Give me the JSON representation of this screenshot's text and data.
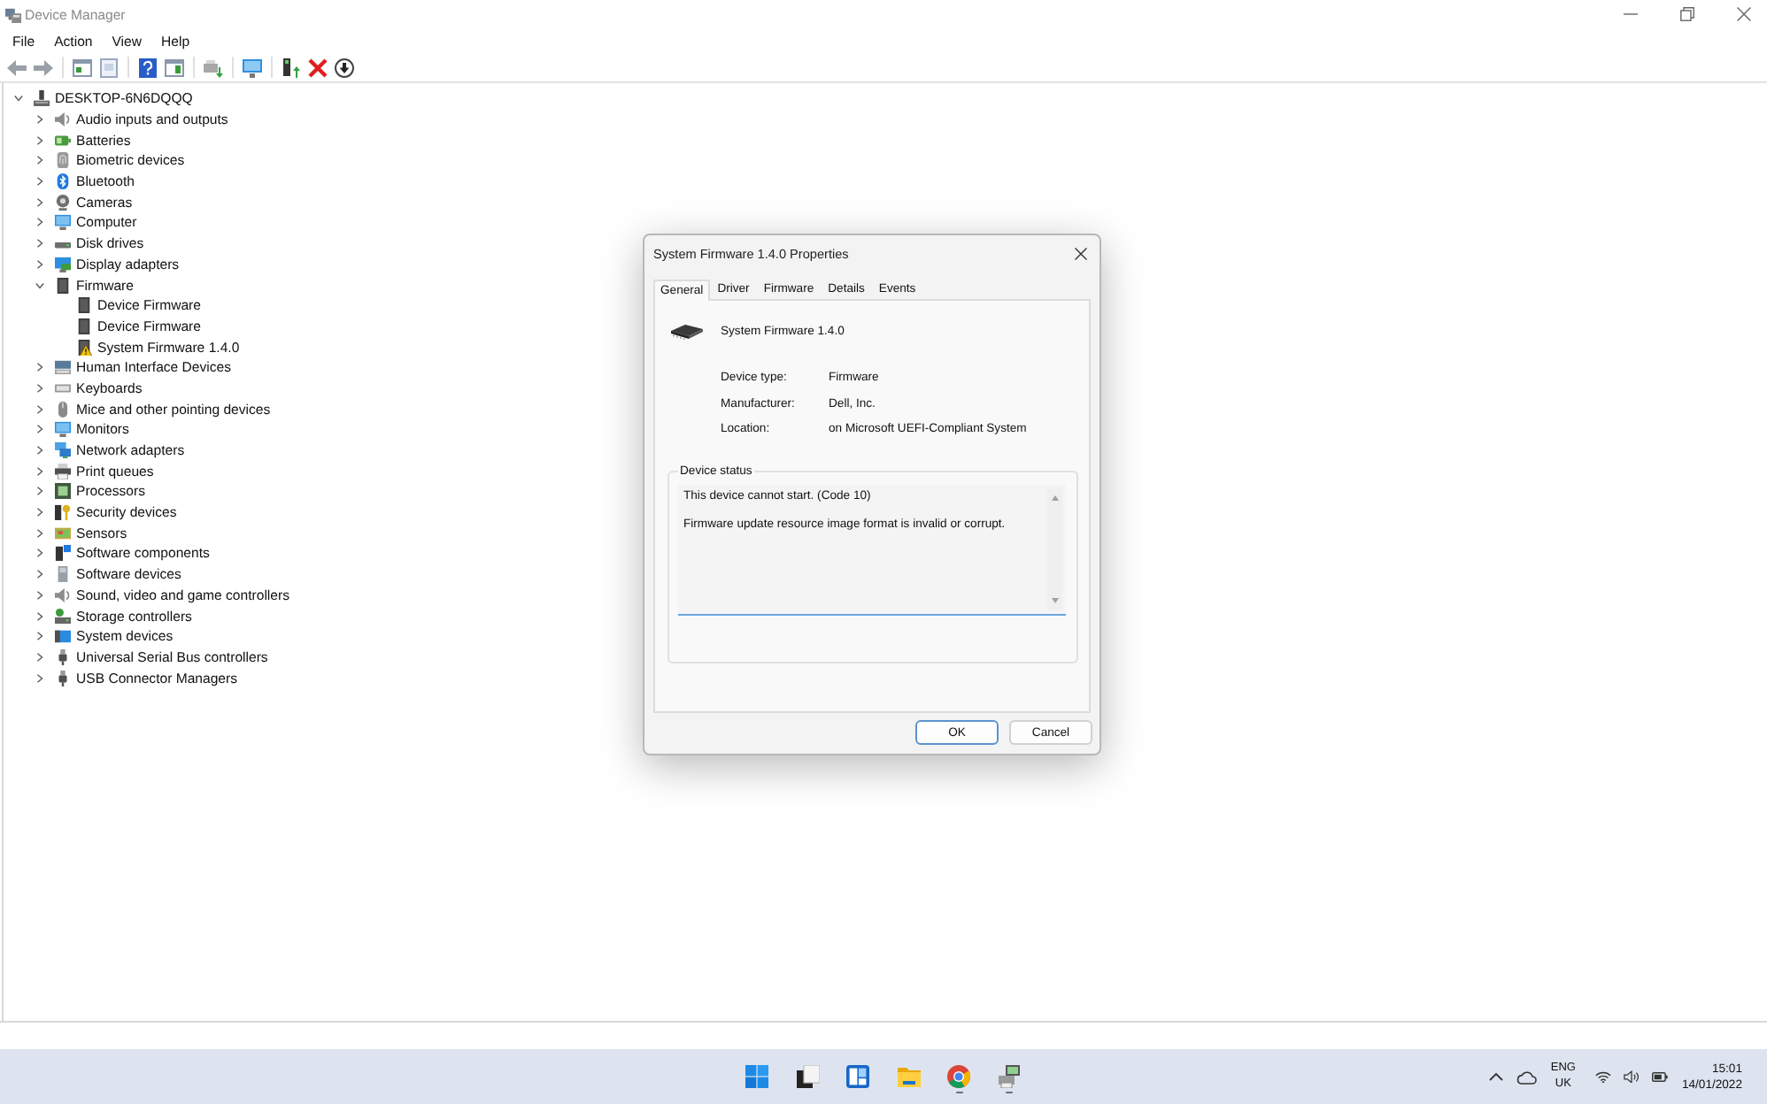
{
  "window": {
    "title": "Device Manager"
  },
  "menu": [
    "File",
    "Action",
    "View",
    "Help"
  ],
  "tree": {
    "label": "DESKTOP-6N6DQQQ",
    "expanded": true,
    "children": [
      {
        "label": "Audio inputs and outputs",
        "expanded": false
      },
      {
        "label": "Batteries",
        "expanded": false
      },
      {
        "label": "Biometric devices",
        "expanded": false
      },
      {
        "label": "Bluetooth",
        "expanded": false
      },
      {
        "label": "Cameras",
        "expanded": false
      },
      {
        "label": "Computer",
        "expanded": false
      },
      {
        "label": "Disk drives",
        "expanded": false
      },
      {
        "label": "Display adapters",
        "expanded": false
      },
      {
        "label": "Firmware",
        "expanded": true,
        "children": [
          {
            "label": "Device Firmware",
            "warning": false
          },
          {
            "label": "Device Firmware",
            "warning": false
          },
          {
            "label": "System Firmware 1.4.0",
            "warning": true
          }
        ]
      },
      {
        "label": "Human Interface Devices",
        "expanded": false
      },
      {
        "label": "Keyboards",
        "expanded": false
      },
      {
        "label": "Mice and other pointing devices",
        "expanded": false
      },
      {
        "label": "Monitors",
        "expanded": false
      },
      {
        "label": "Network adapters",
        "expanded": false
      },
      {
        "label": "Print queues",
        "expanded": false
      },
      {
        "label": "Processors",
        "expanded": false
      },
      {
        "label": "Security devices",
        "expanded": false
      },
      {
        "label": "Sensors",
        "expanded": false
      },
      {
        "label": "Software components",
        "expanded": false
      },
      {
        "label": "Software devices",
        "expanded": false
      },
      {
        "label": "Sound, video and game controllers",
        "expanded": false
      },
      {
        "label": "Storage controllers",
        "expanded": false
      },
      {
        "label": "System devices",
        "expanded": false
      },
      {
        "label": "Universal Serial Bus controllers",
        "expanded": false
      },
      {
        "label": "USB Connector Managers",
        "expanded": false
      }
    ]
  },
  "dialog": {
    "title": "System Firmware 1.4.0 Properties",
    "tabs": [
      {
        "label": "General",
        "selected": true
      },
      {
        "label": "Driver",
        "selected": false
      },
      {
        "label": "Firmware",
        "selected": false
      },
      {
        "label": "Details",
        "selected": false
      },
      {
        "label": "Events",
        "selected": false
      }
    ],
    "device_name": "System Firmware 1.4.0",
    "properties": [
      {
        "label": "Device type:",
        "value": "Firmware"
      },
      {
        "label": "Manufacturer:",
        "value": "Dell, Inc."
      },
      {
        "label": "Location:",
        "value": "on Microsoft UEFI-Compliant System"
      }
    ],
    "device_status": {
      "title": "Device status",
      "messages": [
        "This device cannot start. (Code 10)",
        "Firmware update resource image format is invalid or corrupt."
      ]
    },
    "buttons": [
      {
        "label": "OK",
        "default": true
      },
      {
        "label": "Cancel",
        "default": false
      }
    ]
  },
  "taskbar": {
    "apps": [
      {
        "running": false
      },
      {
        "running": false
      },
      {
        "running": false
      },
      {
        "running": false
      },
      {
        "running": true
      },
      {
        "running": true
      }
    ],
    "tray": {
      "language": "ENG",
      "region": "UK",
      "time": "15:01",
      "date": "14/01/2022"
    }
  }
}
